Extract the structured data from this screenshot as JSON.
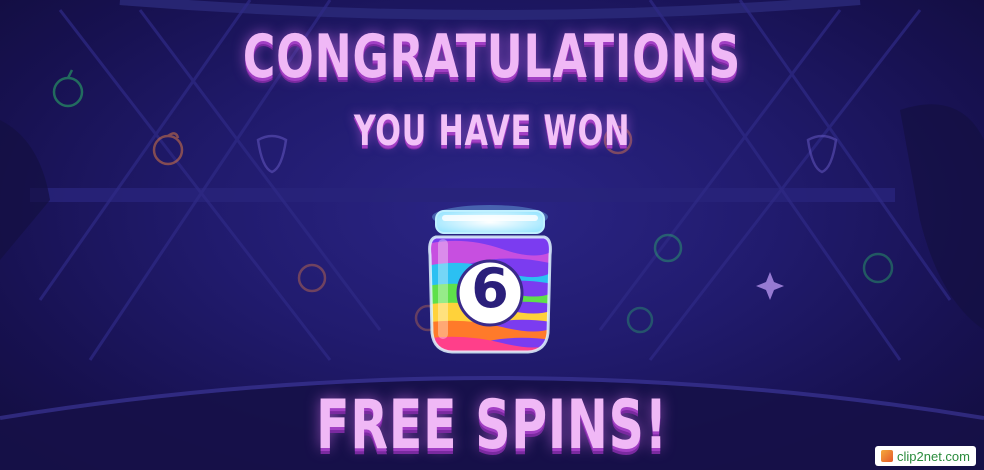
{
  "popup": {
    "headline": "CONGRATULATIONS",
    "subheadline": "YOU HAVE WON",
    "prize_count": "6",
    "prize_label": "FREE SPINS!"
  },
  "watermark": {
    "text": "clip2net.com"
  },
  "colors": {
    "background": "#211b6e",
    "title_text": "#f0b8f6",
    "title_shadow": "#a23fc4",
    "neon_green": "#2fd86a",
    "neon_orange": "#ff8a3d"
  }
}
